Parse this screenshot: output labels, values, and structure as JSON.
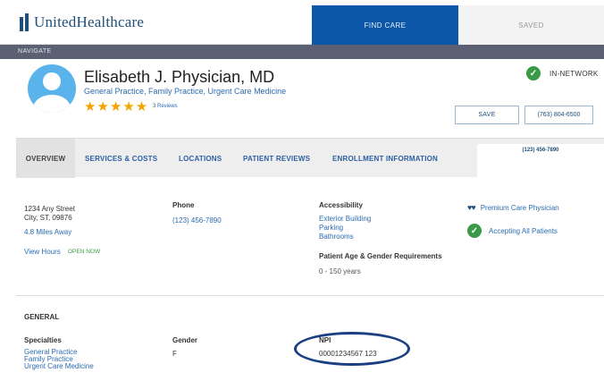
{
  "header": {
    "logo_text": "UnitedHealthcare",
    "find_care_tab": "FIND CARE",
    "saved_tab": "SAVED"
  },
  "navbar": {
    "label": "NAVIGATE"
  },
  "doctor": {
    "name": "Elisabeth J. Physician, MD",
    "specialties_line": "General Practice, Family Practice, Urgent Care Medicine",
    "stars": "★★★★★",
    "reviews": "3 Reviews",
    "network_status": "IN-NETWORK",
    "save_label": "SAVE",
    "phone_button": "(763) 804-6500"
  },
  "tabs": {
    "overview": "OVERVIEW",
    "services": "SERVICES & COSTS",
    "locations": "LOCATIONS",
    "reviews": "PATIENT REVIEWS",
    "enrollment": "ENROLLMENT INFORMATION",
    "phone": "(123) 456-7890"
  },
  "overview": {
    "address_line1": "1234 Any Street",
    "address_line2": "City, ST, 09876",
    "distance": "4.8 Miles Away",
    "view_hours": "View Hours",
    "open_now": "OPEN NOW",
    "phone_label": "Phone",
    "phone_value": "(123) 456-7890",
    "accessibility_label": "Accessibility",
    "accessibility_items": [
      "Exterior Building",
      "Parking",
      "Bathrooms"
    ],
    "age_gender_label": "Patient Age & Gender Requirements",
    "age_range": "0 - 150  years",
    "premium": "Premium Care Physician",
    "accepting": "Accepting All Patients"
  },
  "general": {
    "heading": "GENERAL",
    "specialties_label": "Specialties",
    "specialties": [
      "General Practice",
      "Family Practice",
      "Urgent Care Medicine"
    ],
    "gender_label": "Gender",
    "gender_value": "F",
    "npi_label": "NPI",
    "npi_value": "00001234567 123"
  },
  "colors": {
    "brand_blue": "#0c57a8",
    "navbar": "#5b6172",
    "star": "#f4a300",
    "check_green": "#3a9a48",
    "link": "#2b6cb0",
    "highlight_ellipse": "#1b3f82"
  }
}
